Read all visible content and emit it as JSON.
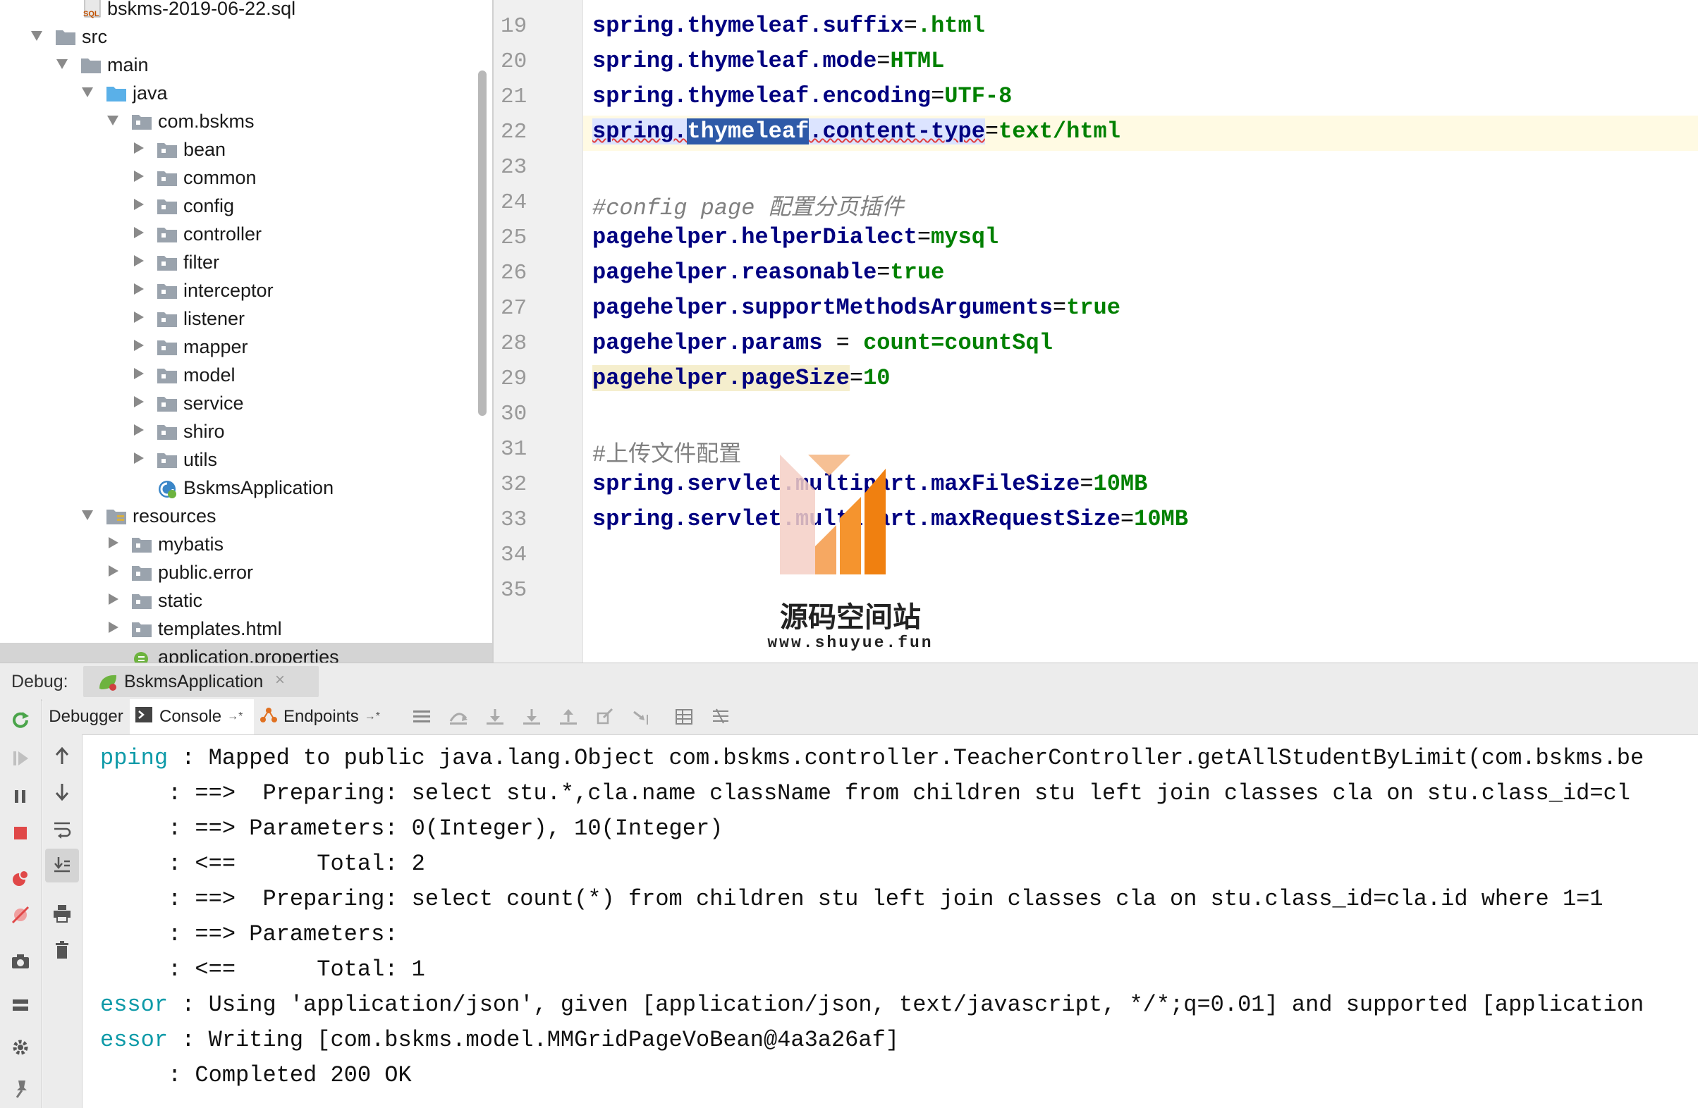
{
  "tree": {
    "items": [
      {
        "label": "bskms-2019-06-22.sql",
        "icon": "sql-file-icon",
        "depth": 2
      },
      {
        "label": "src",
        "icon": "folder-icon",
        "depth": 0,
        "expanded": true
      },
      {
        "label": "main",
        "icon": "folder-icon",
        "depth": 1,
        "expanded": true
      },
      {
        "label": "java",
        "icon": "source-folder-icon",
        "depth": 2,
        "expanded": true
      },
      {
        "label": "com.bskms",
        "icon": "package-icon",
        "depth": 3,
        "expanded": true
      },
      {
        "label": "bean",
        "icon": "package-icon",
        "depth": 4,
        "expanded": false
      },
      {
        "label": "common",
        "icon": "package-icon",
        "depth": 4,
        "expanded": false
      },
      {
        "label": "config",
        "icon": "package-icon",
        "depth": 4,
        "expanded": false
      },
      {
        "label": "controller",
        "icon": "package-icon",
        "depth": 4,
        "expanded": false
      },
      {
        "label": "filter",
        "icon": "package-icon",
        "depth": 4,
        "expanded": false
      },
      {
        "label": "interceptor",
        "icon": "package-icon",
        "depth": 4,
        "expanded": false
      },
      {
        "label": "listener",
        "icon": "package-icon",
        "depth": 4,
        "expanded": false
      },
      {
        "label": "mapper",
        "icon": "package-icon",
        "depth": 4,
        "expanded": false
      },
      {
        "label": "model",
        "icon": "package-icon",
        "depth": 4,
        "expanded": false
      },
      {
        "label": "service",
        "icon": "package-icon",
        "depth": 4,
        "expanded": false
      },
      {
        "label": "shiro",
        "icon": "package-icon",
        "depth": 4,
        "expanded": false
      },
      {
        "label": "utils",
        "icon": "package-icon",
        "depth": 4,
        "expanded": false
      },
      {
        "label": "BskmsApplication",
        "icon": "spring-boot-class-icon",
        "depth": 4
      },
      {
        "label": "resources",
        "icon": "resources-folder-icon",
        "depth": 2,
        "expanded": true
      },
      {
        "label": "mybatis",
        "icon": "folder-icon",
        "depth": 3,
        "expanded": false
      },
      {
        "label": "public.error",
        "icon": "folder-icon",
        "depth": 3,
        "expanded": false
      },
      {
        "label": "static",
        "icon": "folder-icon",
        "depth": 3,
        "expanded": false
      },
      {
        "label": "templates.html",
        "icon": "folder-icon",
        "depth": 3,
        "expanded": false
      },
      {
        "label": "application.properties",
        "icon": "properties-file-icon",
        "depth": 3,
        "selected": true
      }
    ]
  },
  "editor": {
    "line_numbers": [
      "19",
      "20",
      "21",
      "22",
      "23",
      "24",
      "25",
      "26",
      "27",
      "28",
      "29",
      "30",
      "31",
      "32",
      "33",
      "34",
      "35"
    ],
    "lines": {
      "l19": {
        "key": "spring.thymeleaf.suffix",
        "eq": "=",
        "val": ".html"
      },
      "l20": {
        "key": "spring.thymeleaf.mode",
        "eq": "=",
        "val": "HTML"
      },
      "l21": {
        "key": "spring.thymeleaf.encoding",
        "eq": "=",
        "val": "UTF-8"
      },
      "l22": {
        "key_a": "spring.",
        "key_sel": "thymeleaf",
        "key_b": ".content-type",
        "eq": "=",
        "val": "text/html"
      },
      "l24": {
        "comment": "#config page 配置分页插件"
      },
      "l25": {
        "key": "pagehelper.helperDialect",
        "eq": "=",
        "val": "mysql"
      },
      "l26": {
        "key": "pagehelper.reasonable",
        "eq": "=",
        "val": "true"
      },
      "l27": {
        "key": "pagehelper.supportMethodsArguments",
        "eq": "=",
        "val": "true"
      },
      "l28": {
        "key": "pagehelper.params",
        "eq": " = ",
        "val": "count=countSql"
      },
      "l29": {
        "key": "pagehelper.pageSize",
        "eq": "=",
        "val": "10"
      },
      "l31": {
        "comment": "#上传文件配置"
      },
      "l32": {
        "key": "spring.servlet.multipart.maxFileSize",
        "eq": "=",
        "val": "10MB"
      },
      "l33": {
        "key": "spring.servlet.multipart.maxRequestSize",
        "eq": "=",
        "val": "10MB"
      }
    },
    "current_line": "22"
  },
  "watermark": {
    "title": "源码空间站",
    "url": "www.shuyue.fun"
  },
  "debug": {
    "label": "Debug:",
    "session": "BskmsApplication",
    "close_glyph": "×",
    "tabs": {
      "debugger": "Debugger",
      "console": "Console",
      "endpoints": "Endpoints"
    }
  },
  "console": {
    "lines": [
      {
        "tag": "pping",
        "text": " : Mapped to public java.lang.Object com.bskms.controller.TeacherController.getAllStudentByLimit(com.bskms.be"
      },
      {
        "tag": "",
        "text": "     : ==>  Preparing: select stu.*,cla.name className from children stu left join classes cla on stu.class_id=cl"
      },
      {
        "tag": "",
        "text": "     : ==> Parameters: 0(Integer), 10(Integer)"
      },
      {
        "tag": "",
        "text": "     : <==      Total: 2"
      },
      {
        "tag": "",
        "text": "     : ==>  Preparing: select count(*) from children stu left join classes cla on stu.class_id=cla.id where 1=1"
      },
      {
        "tag": "",
        "text": "     : ==> Parameters: "
      },
      {
        "tag": "",
        "text": "     : <==      Total: 1"
      },
      {
        "tag": "essor",
        "text": " : Using 'application/json', given [application/json, text/javascript, */*;q=0.01] and supported [application"
      },
      {
        "tag": "essor",
        "text": " : Writing [com.bskms.model.MMGridPageVoBean@4a3a26af]"
      },
      {
        "tag": "",
        "text": "     : Completed 200 OK"
      }
    ]
  },
  "colors": {
    "key": "#000080",
    "value": "#008000",
    "comment": "#808080",
    "console_tag": "#0e9aa8",
    "current_line": "#fffae3",
    "selection": "#2e5aa8"
  }
}
